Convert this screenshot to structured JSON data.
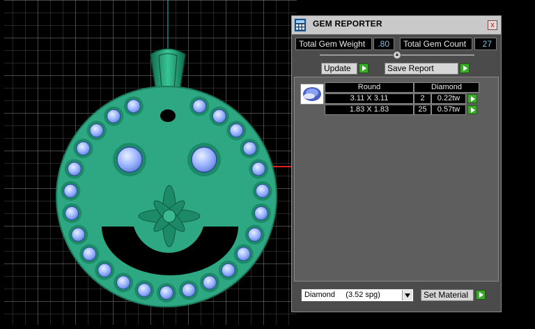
{
  "panel": {
    "title": "GEM REPORTER",
    "close_label": "x",
    "total_weight_label": "Total Gem Weight",
    "total_weight_value": ".80",
    "total_count_label": "Total Gem Count",
    "total_count_value": "27",
    "update_label": "Update",
    "save_report_label": "Save Report",
    "table": {
      "shape": "Round",
      "material": "Diamond",
      "rows": [
        {
          "size": "3.11 X 3.11",
          "count": "2",
          "weight": "0.22tw"
        },
        {
          "size": "1.83 X 1.83",
          "count": "25",
          "weight": "0.57tw"
        }
      ]
    },
    "material_select_value": "Diamond     (3.52 spg)",
    "set_material_label": "Set Material"
  },
  "colors": {
    "pendant": "#2ea783",
    "gem": "#9cb6ff",
    "background_grid": "#6e6e6e",
    "accent_play": "#3bab29"
  }
}
